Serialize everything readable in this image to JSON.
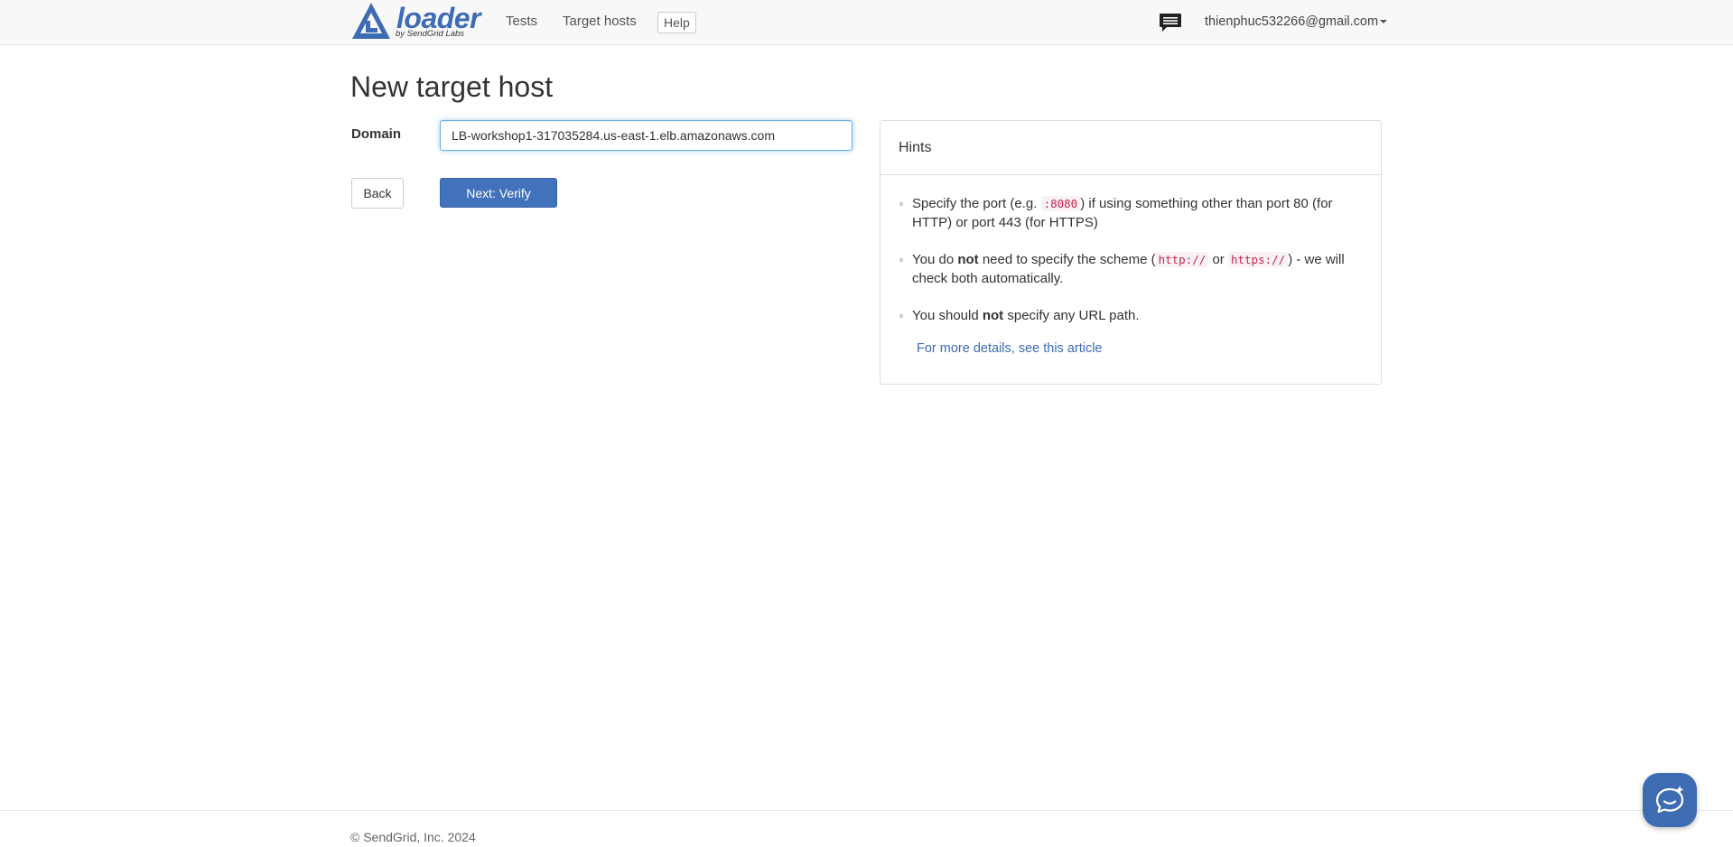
{
  "navbar": {
    "logo_word": "loader",
    "logo_sub": "by SendGrid Labs",
    "links": {
      "tests": "Tests",
      "target_hosts": "Target hosts",
      "help": "Help"
    },
    "user_email": "thienphuc532266@gmail.com",
    "icons": {
      "messages": "chat-bubble-icon",
      "user_caret": "caret-down-icon"
    }
  },
  "main": {
    "title": "New target host",
    "domain_label": "Domain",
    "domain_value": "LB-workshop1-317035284.us-east-1.elb.amazonaws.com",
    "back_label": "Back",
    "next_label": "Next: Verify"
  },
  "hints": {
    "title": "Hints",
    "items": [
      {
        "pre": "Specify the port (e.g. ",
        "code": ":8080",
        "post": ") if using something other than port 80 (for HTTP) or port 443 (for HTTPS)"
      },
      {
        "pre": "You do ",
        "bold": "not",
        "mid": " need to specify the scheme (",
        "code1": "http://",
        "or": " or ",
        "code2": "https://",
        "post": ") - we will check both automatically."
      },
      {
        "pre": "You should ",
        "bold": "not",
        "post": " specify any URL path."
      }
    ],
    "more_link": "For more details, see this article"
  },
  "footer": {
    "copyright": "© SendGrid, Inc. 2024"
  },
  "support_widget": {
    "icon": "chat-support-icon"
  },
  "colors": {
    "brand": "#3d6cb3",
    "primary_button": "#4272bb",
    "code_text": "#c7254e",
    "code_bg": "#f9f2f4",
    "focus_border": "#66afe9"
  }
}
